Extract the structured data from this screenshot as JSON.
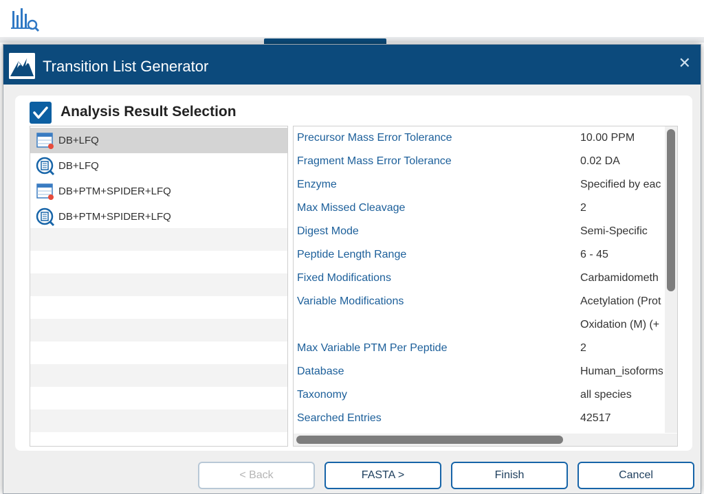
{
  "dialog": {
    "title": "Transition List Generator",
    "close_glyph": "✕"
  },
  "section": {
    "title": "Analysis Result Selection",
    "checked": true
  },
  "analyses": [
    {
      "label": "DB+LFQ",
      "icon": "table-result-icon",
      "selected": true
    },
    {
      "label": "DB+LFQ",
      "icon": "search-report-icon",
      "selected": false
    },
    {
      "label": "DB+PTM+SPIDER+LFQ",
      "icon": "table-result-icon",
      "selected": false
    },
    {
      "label": "DB+PTM+SPIDER+LFQ",
      "icon": "search-report-icon",
      "selected": false
    }
  ],
  "parameters": [
    {
      "key": "Precursor Mass Error Tolerance",
      "value": "10.00 PPM"
    },
    {
      "key": "Fragment Mass Error Tolerance",
      "value": "0.02 DA"
    },
    {
      "key": "Enzyme",
      "value": "Specified by eac"
    },
    {
      "key": "Max Missed Cleavage",
      "value": "2"
    },
    {
      "key": "Digest Mode",
      "value": "Semi-Specific"
    },
    {
      "key": "Peptide Length Range",
      "value": "6 - 45"
    },
    {
      "key": "Fixed Modifications",
      "value": "Carbamidometh"
    },
    {
      "key": "Variable Modifications",
      "value": "Acetylation (Prot"
    },
    {
      "key": "",
      "value": "Oxidation (M) (+"
    },
    {
      "key": "Max Variable PTM Per Peptide",
      "value": "2"
    },
    {
      "key": "Database",
      "value": "Human_isoforms"
    },
    {
      "key": "Taxonomy",
      "value": "all species"
    },
    {
      "key": "Searched Entries",
      "value": "42517"
    }
  ],
  "buttons": {
    "back": "< Back",
    "fasta": "FASTA >",
    "finish": "Finish",
    "cancel": "Cancel"
  },
  "colors": {
    "titlebar": "#0c4a7c",
    "accent": "#1664a8",
    "param_key": "#1c5f9a"
  }
}
